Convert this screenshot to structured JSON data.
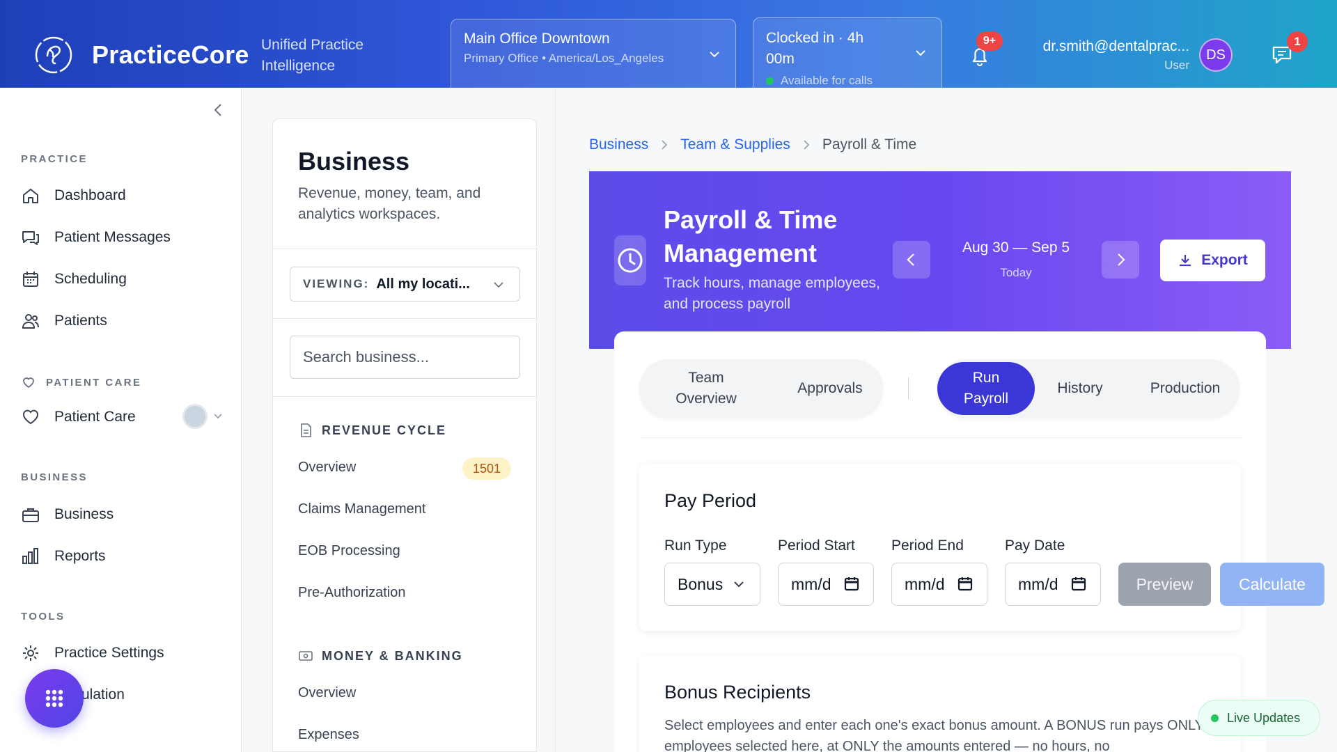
{
  "header": {
    "brand": "PracticeCore",
    "tagline": "Unified Practice Intelligence",
    "location": {
      "title": "Main Office Downtown",
      "subtitle": "Primary Office • America/Los_Angeles"
    },
    "clock": {
      "title": "Clocked in · 4h 00m",
      "status": "Available for calls",
      "status_color": "#22c55e"
    },
    "notifications_badge": "9+",
    "user": {
      "email": "dr.smith@dentalprac...",
      "role": "User",
      "initials": "DS"
    },
    "messages_badge": "1"
  },
  "sidebar": {
    "sections": [
      {
        "label": "PRACTICE",
        "items": [
          {
            "label": "Dashboard",
            "icon": "home-icon"
          },
          {
            "label": "Patient Messages",
            "icon": "messages-icon"
          },
          {
            "label": "Scheduling",
            "icon": "calendar-icon"
          },
          {
            "label": "Patients",
            "icon": "users-icon"
          }
        ]
      },
      {
        "label": "PATIENT CARE",
        "items": [
          {
            "label": "Patient Care",
            "icon": "heart-icon"
          }
        ]
      },
      {
        "label": "BUSINESS",
        "items": [
          {
            "label": "Business",
            "icon": "briefcase-icon"
          },
          {
            "label": "Reports",
            "icon": "bar-chart-icon"
          }
        ]
      },
      {
        "label": "TOOLS",
        "items": [
          {
            "label": "Practice Settings",
            "icon": "gear-icon"
          },
          {
            "label": "ulation",
            "icon": "apps-icon"
          }
        ]
      }
    ]
  },
  "panel": {
    "title": "Business",
    "description": "Revenue, money, team, and analytics workspaces.",
    "viewing_label": "VIEWING:",
    "viewing_value": "All my locati...",
    "search_placeholder": "Search business...",
    "groups": [
      {
        "label": "REVENUE CYCLE",
        "items": [
          {
            "label": "Overview",
            "badge": "1501"
          },
          {
            "label": "Claims Management"
          },
          {
            "label": "EOB Processing"
          },
          {
            "label": "Pre-Authorization"
          }
        ]
      },
      {
        "label": "MONEY & BANKING",
        "items": [
          {
            "label": "Overview"
          },
          {
            "label": "Expenses"
          }
        ]
      }
    ]
  },
  "breadcrumb": [
    "Business",
    "Team & Supplies",
    "Payroll & Time"
  ],
  "hero": {
    "title": "Payroll & Time Management",
    "description": "Track hours, manage employees, and process payroll",
    "range": "Aug 30 — Sep 5",
    "range_sub": "Today",
    "export_label": "Export"
  },
  "tabs": {
    "left": [
      "Team Overview",
      "Approvals"
    ],
    "right": [
      "Run Payroll",
      "History",
      "Production"
    ],
    "active": "Run Payroll"
  },
  "pay_period": {
    "title": "Pay Period",
    "fields": [
      {
        "label": "Run Type",
        "value": "Bonus"
      },
      {
        "label": "Period Start",
        "value": "mm/d"
      },
      {
        "label": "Period End",
        "value": "mm/d"
      },
      {
        "label": "Pay Date",
        "value": "mm/d"
      }
    ],
    "preview_label": "Preview",
    "calculate_label": "Calculate"
  },
  "bonus_recipients": {
    "title": "Bonus Recipients",
    "description": "Select employees and enter each one's exact bonus amount. A BONUS run pays ONLY the employees selected here, at ONLY the amounts entered — no hours, no"
  },
  "live_updates": "Live Updates",
  "colors": {
    "primary": "#3b36d6",
    "hero_start": "#5b4ce8",
    "hero_end": "#8b5cf6",
    "link": "#2563eb"
  }
}
